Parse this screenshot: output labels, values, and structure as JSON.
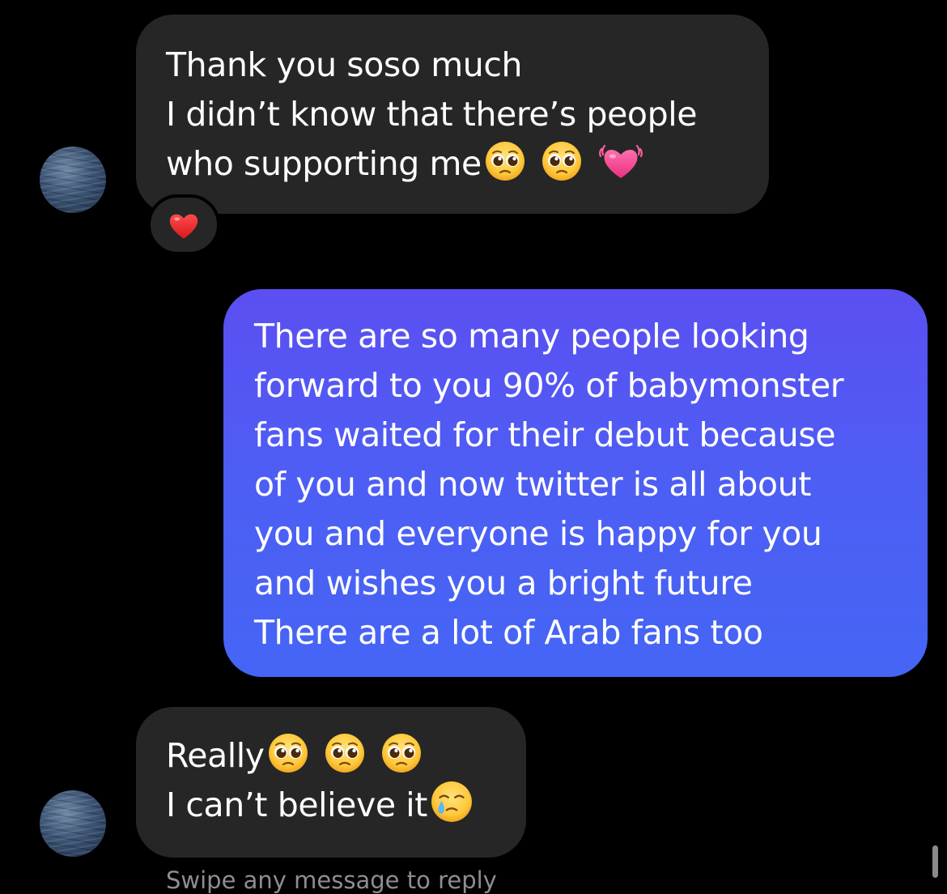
{
  "messages": [
    {
      "direction": "incoming",
      "lines": [
        "Thank you soso much",
        "I didn’t know that there’s people",
        "who supporting me"
      ],
      "emojis": [
        "pleading-face",
        "pleading-face",
        "beating-heart"
      ],
      "reaction": "red-heart"
    },
    {
      "direction": "outgoing",
      "lines": [
        "There are so many people looking",
        "forward to you 90% of babymonster",
        "fans waited for their debut because",
        "of you and now twitter is all about",
        "you and everyone is happy for you",
        "and wishes you a bright future",
        "There are a lot of Arab fans too"
      ]
    },
    {
      "direction": "incoming",
      "lines": [
        "Really",
        "I can’t believe it"
      ],
      "emojis_line1": [
        "pleading-face",
        "pleading-face",
        "pleading-face"
      ],
      "emojis_line2": [
        "face-holding-back-tears"
      ]
    }
  ],
  "footer": {
    "swipe_hint": "Swipe any message to reply"
  },
  "colors": {
    "background": "#000000",
    "incoming_bubble": "#262626",
    "outgoing_gradient_top": "#5b4ff2",
    "outgoing_gradient_bottom": "#4565f5",
    "text": "#ffffff"
  }
}
